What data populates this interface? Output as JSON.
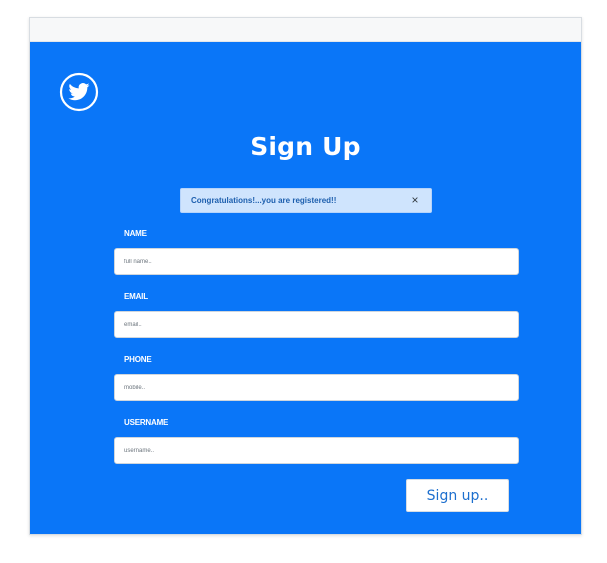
{
  "colors": {
    "page_background": "#ffffff",
    "panel_background": "#0a76f8",
    "top_strip": "#f7f8f9",
    "alert_background": "#cfe4fd",
    "alert_text": "#1d5fae",
    "button_text": "#1d6fce"
  },
  "logo": {
    "icon": "twitter-bird-icon"
  },
  "form": {
    "title": "Sign Up",
    "alert": {
      "message": "Congratulations!...you are registered!!",
      "close_glyph": "×"
    },
    "fields": {
      "name": {
        "label": "NAME",
        "placeholder": "full name..",
        "value": ""
      },
      "email": {
        "label": "EMAIL",
        "placeholder": "email..",
        "value": ""
      },
      "phone": {
        "label": "PHONE",
        "placeholder": "mobile..",
        "value": ""
      },
      "username": {
        "label": "USERNAME",
        "placeholder": "username..",
        "value": ""
      }
    },
    "submit_label": "Sign up.."
  }
}
